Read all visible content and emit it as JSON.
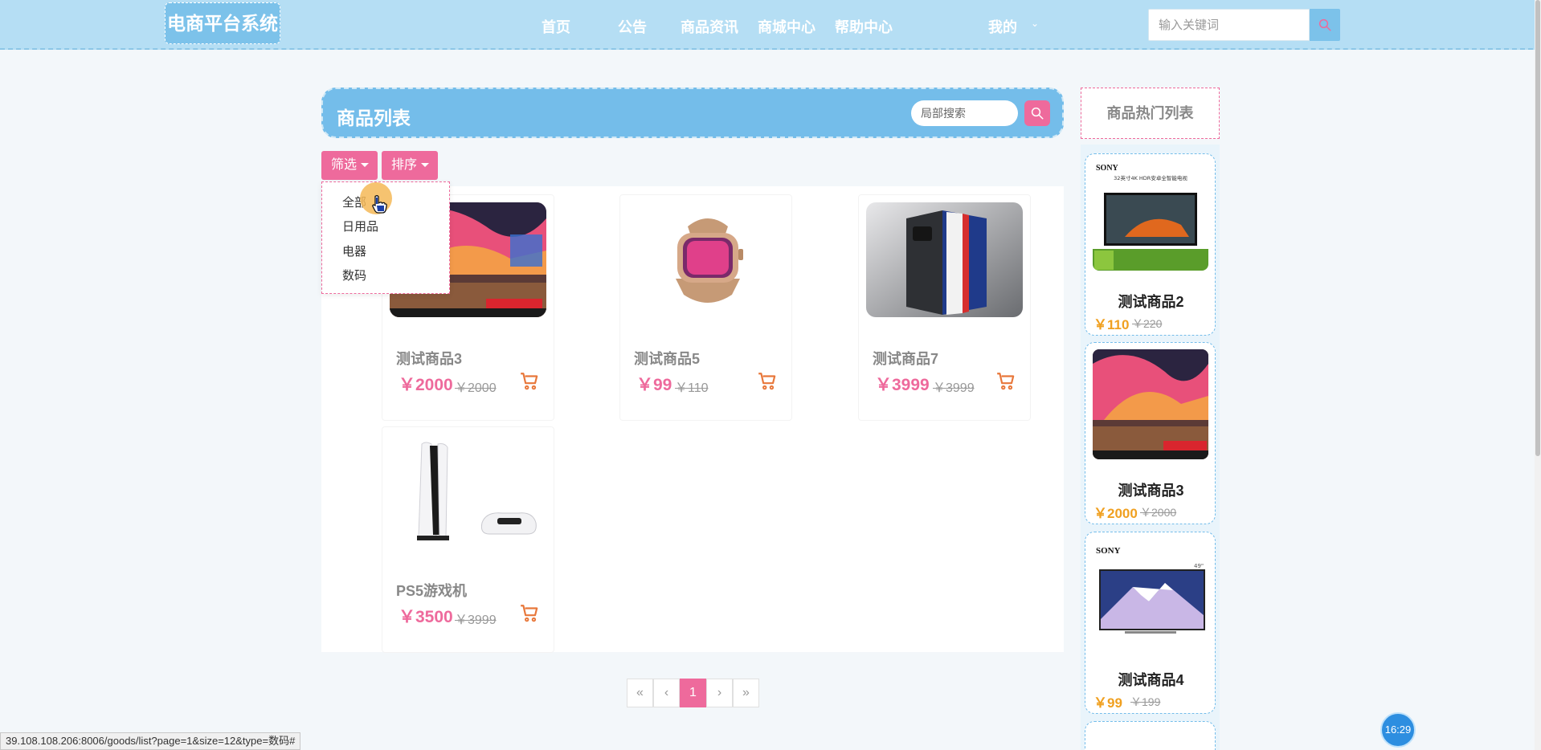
{
  "header": {
    "logo": "电商平台系统",
    "nav": [
      "首页",
      "公告",
      "商品资讯",
      "商城中心",
      "帮助中心",
      "我的"
    ],
    "search_placeholder": "输入关键词"
  },
  "list": {
    "title": "商品列表",
    "local_search_placeholder": "局部搜索",
    "filter_label": "筛选",
    "sort_label": "排序",
    "dropdown": [
      "全部",
      "日用品",
      "电器",
      "数码"
    ]
  },
  "products": [
    {
      "name": "测试商品3",
      "price": "￥2000",
      "old_price": "￥2000",
      "image": "mac-desktop"
    },
    {
      "name": "测试商品5",
      "price": "￥99",
      "old_price": "￥110",
      "image": "smartwatch"
    },
    {
      "name": "测试商品7",
      "price": "￥3999",
      "old_price": "￥3999",
      "image": "phone"
    },
    {
      "name": "PS5游戏机",
      "price": "￥3500",
      "old_price": "￥3999",
      "image": "ps5"
    }
  ],
  "pagination": {
    "first": "«",
    "prev": "‹",
    "current": "1",
    "next": "›",
    "last": "»"
  },
  "hot": {
    "title": "商品热门列表",
    "items": [
      {
        "name": "测试商品2",
        "price": "￥110",
        "old_price": "￥220",
        "image": "sony-tv",
        "brand": "SONY",
        "banner": "32英寸4K HDR安卓全智能电视"
      },
      {
        "name": "测试商品3",
        "price": "￥2000",
        "old_price": "￥2000",
        "image": "mac-desktop"
      },
      {
        "name": "测试商品4",
        "price": "￥99",
        "old_price": "￥199",
        "image": "sony-tv-mountain",
        "brand": "SONY",
        "size_label": "49\""
      }
    ]
  },
  "status_url": "39.108.108.206:8006/goods/list?page=1&size=12&type=数码#",
  "clock": "16:29",
  "colors": {
    "header": "#b5def4",
    "accent_blue": "#74bdea",
    "accent_pink": "#ee6a9c",
    "hot_price": "#f0a020"
  }
}
